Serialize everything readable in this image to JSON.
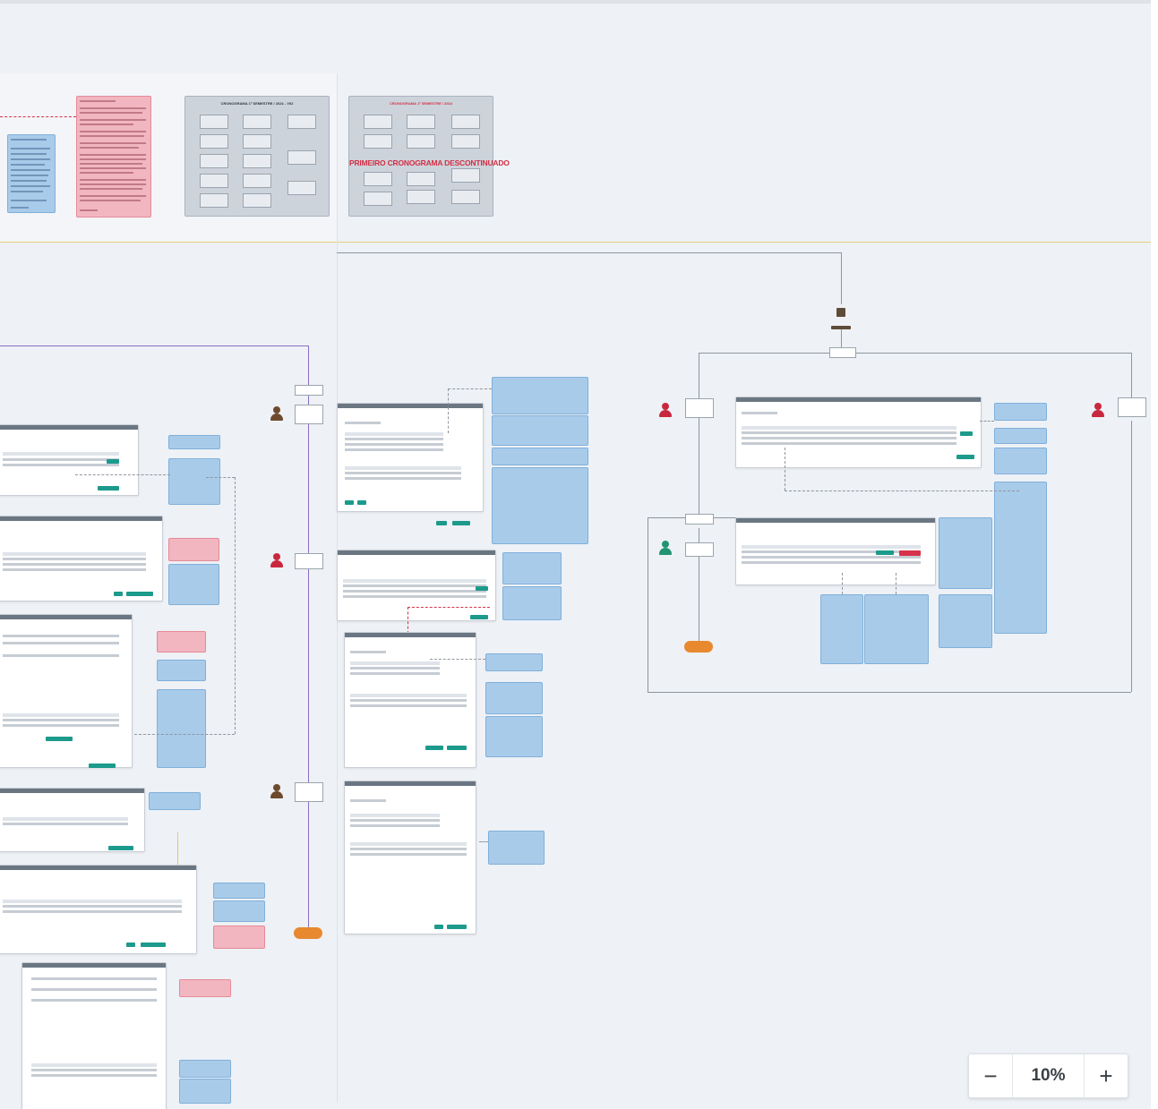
{
  "canvas": {
    "panels": [
      {
        "title": "CRONOGRAMA 1º SEMESTRE / 2024 - V02",
        "stamp": ""
      },
      {
        "title": "CRONOGRAMA 1º SEMESTRE / 2024",
        "stamp": "PRIMEIRO CRONOGRAMA DESCONTINUADO"
      }
    ]
  },
  "zoom": {
    "minus_label": "−",
    "value": "10%",
    "plus_label": "+"
  }
}
